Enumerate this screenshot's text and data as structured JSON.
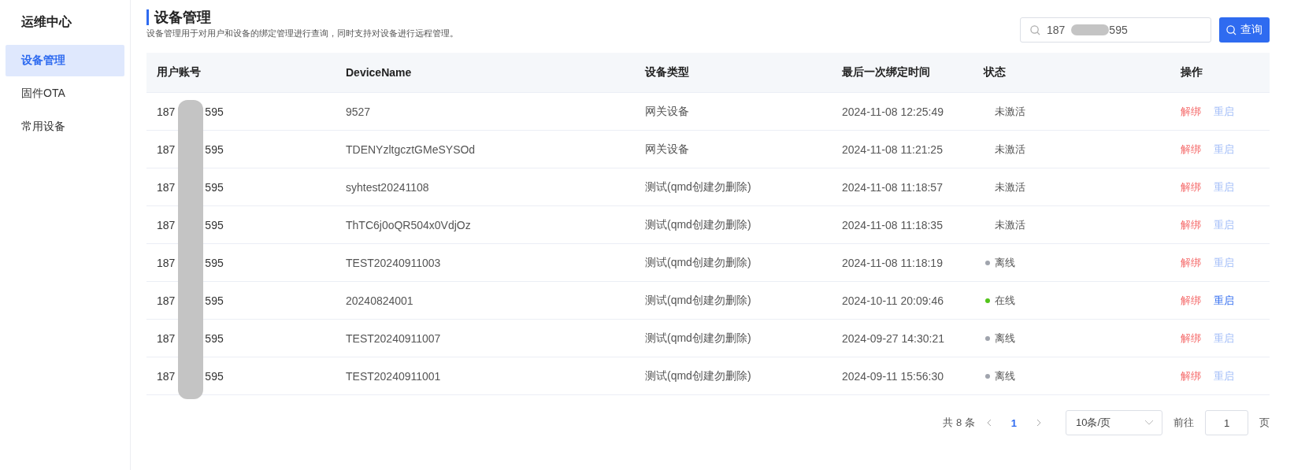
{
  "sidebar": {
    "title": "运维中心",
    "items": [
      {
        "label": "设备管理",
        "selected": true
      },
      {
        "label": "固件OTA",
        "selected": false
      },
      {
        "label": "常用设备",
        "selected": false
      }
    ]
  },
  "header": {
    "title": "设备管理",
    "description": "设备管理用于对用户和设备的绑定管理进行查询，同时支持对设备进行远程管理。"
  },
  "search": {
    "value_start": "187",
    "value_end": "595",
    "button": "查询"
  },
  "table": {
    "columns": [
      "用户账号",
      "DeviceName",
      "设备类型",
      "最后一次绑定时间",
      "状态",
      "操作"
    ],
    "rows": [
      {
        "account_start": "187",
        "account_end": "595",
        "device_name": "9527",
        "device_type": "网关设备",
        "bound_at": "2024-11-08 12:25:49",
        "status": "未激活",
        "unbind": "解绑",
        "restart": "重启",
        "restart_disabled": true
      },
      {
        "account_start": "187",
        "account_end": "595",
        "device_name": "TDENYzltgcztGMeSYSOd",
        "device_type": "网关设备",
        "bound_at": "2024-11-08 11:21:25",
        "status": "未激活",
        "unbind": "解绑",
        "restart": "重启",
        "restart_disabled": true
      },
      {
        "account_start": "187",
        "account_end": "595",
        "device_name": "syhtest20241108",
        "device_type": "测试(qmd创建勿删除)",
        "bound_at": "2024-11-08 11:18:57",
        "status": "未激活",
        "unbind": "解绑",
        "restart": "重启",
        "restart_disabled": true
      },
      {
        "account_start": "187",
        "account_end": "595",
        "device_name": "ThTC6j0oQR504x0VdjOz",
        "device_type": "测试(qmd创建勿删除)",
        "bound_at": "2024-11-08 11:18:35",
        "status": "未激活",
        "unbind": "解绑",
        "restart": "重启",
        "restart_disabled": true
      },
      {
        "account_start": "187",
        "account_end": "595",
        "device_name": "TEST20240911003",
        "device_type": "测试(qmd创建勿删除)",
        "bound_at": "2024-11-08 11:18:19",
        "status": "离线",
        "color": "#a0a4ad",
        "unbind": "解绑",
        "restart": "重启",
        "restart_disabled": true
      },
      {
        "account_start": "187",
        "account_end": "595",
        "device_name": "20240824001",
        "device_type": "测试(qmd创建勿删除)",
        "bound_at": "2024-10-11 20:09:46",
        "status": "在线",
        "color": "#52c41a",
        "unbind": "解绑",
        "restart": "重启",
        "restart_disabled": false
      },
      {
        "account_start": "187",
        "account_end": "595",
        "device_name": "TEST20240911007",
        "device_type": "测试(qmd创建勿删除)",
        "bound_at": "2024-09-27 14:30:21",
        "status": "离线",
        "color": "#a0a4ad",
        "unbind": "解绑",
        "restart": "重启",
        "restart_disabled": true
      },
      {
        "account_start": "187",
        "account_end": "595",
        "device_name": "TEST20240911001",
        "device_type": "测试(qmd创建勿删除)",
        "bound_at": "2024-09-11 15:56:30",
        "status": "离线",
        "color": "#a0a4ad",
        "unbind": "解绑",
        "restart": "重启",
        "restart_disabled": true
      }
    ]
  },
  "pagination": {
    "total": "共 8 条",
    "pages": [
      {
        "label": "1",
        "selected": true
      }
    ],
    "page_size": "10条/页",
    "goto_label": "前往",
    "goto_value": "1",
    "goto_suffix": "页"
  }
}
